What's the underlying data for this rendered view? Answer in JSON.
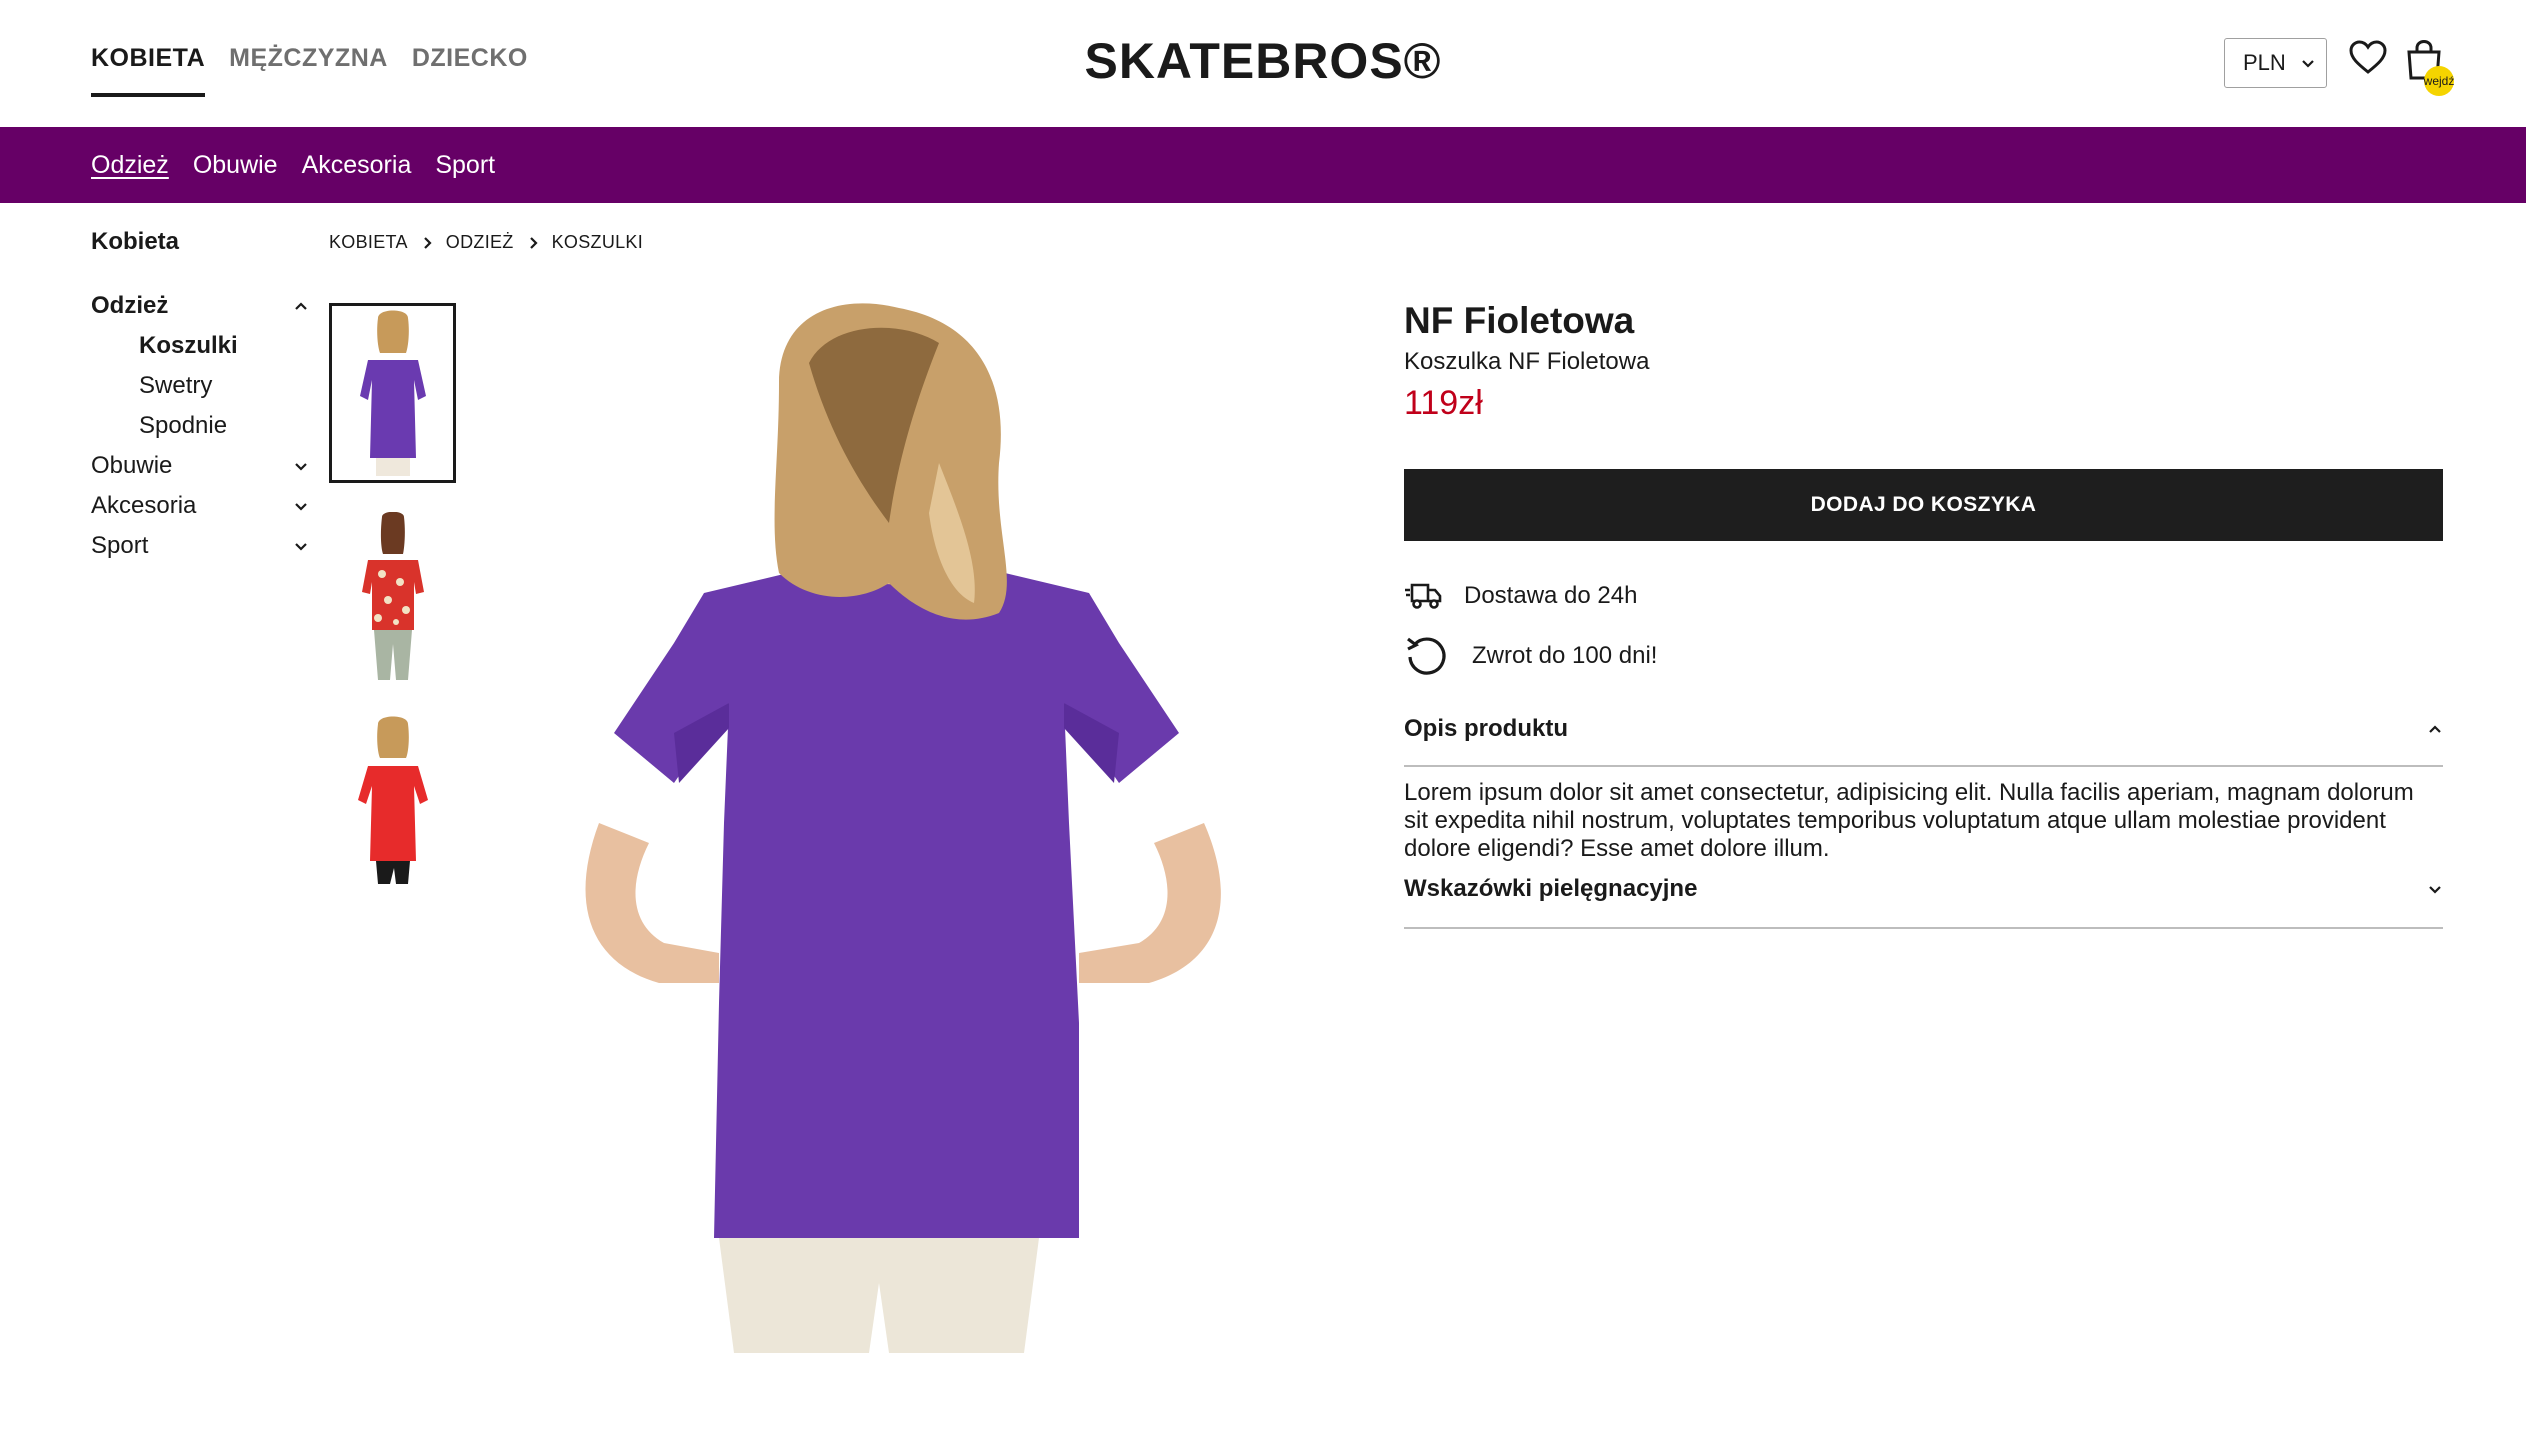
{
  "header": {
    "gender_tabs": [
      {
        "label": "KOBIETA",
        "active": true
      },
      {
        "label": "MĘŻCZYZNA",
        "active": false
      },
      {
        "label": "DZIECKO",
        "active": false
      }
    ],
    "logo": "SKATEBROS®",
    "currency": "PLN",
    "cart_badge": "wejdź",
    "icons": {
      "wishlist": "heart-icon",
      "cart": "shopping-bag-icon",
      "currency_dropdown": "chevron-down-icon"
    }
  },
  "category_bar": {
    "items": [
      {
        "label": "Odzież",
        "active": true
      },
      {
        "label": "Obuwie",
        "active": false
      },
      {
        "label": "Akcesoria",
        "active": false
      },
      {
        "label": "Sport",
        "active": false
      }
    ],
    "color": "#660066"
  },
  "sidebar": {
    "title": "Kobieta",
    "groups": [
      {
        "label": "Odzież",
        "expanded": true,
        "subitems": [
          "Koszulki",
          "Swetry",
          "Spodnie"
        ],
        "active_sub": "Koszulki"
      },
      {
        "label": "Obuwie",
        "expanded": false
      },
      {
        "label": "Akcesoria",
        "expanded": false
      },
      {
        "label": "Sport",
        "expanded": false
      }
    ]
  },
  "breadcrumb": [
    "KOBIETA",
    "ODZIEŻ",
    "KOSZULKI"
  ],
  "gallery": {
    "thumbnails": [
      {
        "name": "purple-tunic-back",
        "active": true
      },
      {
        "name": "red-floral-top",
        "active": false
      },
      {
        "name": "red-tunic-back",
        "active": false
      }
    ]
  },
  "product": {
    "name": "NF Fioletowa",
    "subtitle": "Koszulka NF Fioletowa",
    "price": "119zł",
    "price_color": "#c0001a",
    "add_to_cart": "DODAJ DO KOSZYKA",
    "features": [
      {
        "icon": "delivery-truck-icon",
        "text": "Dostawa do 24h"
      },
      {
        "icon": "return-arrow-icon",
        "text": "Zwrot do 100 dni!"
      }
    ],
    "accordions": [
      {
        "title": "Opis produktu",
        "expanded": true,
        "body": "Lorem ipsum dolor sit amet consectetur, adipisicing elit. Nulla facilis aperiam, magnam dolorum sit expedita nihil nostrum, voluptates temporibus voluptatum atque ullam molestiae provident dolore eligendi? Esse amet dolore illum."
      },
      {
        "title": "Wskazówki pielęgnacyjne",
        "expanded": false
      }
    ]
  }
}
